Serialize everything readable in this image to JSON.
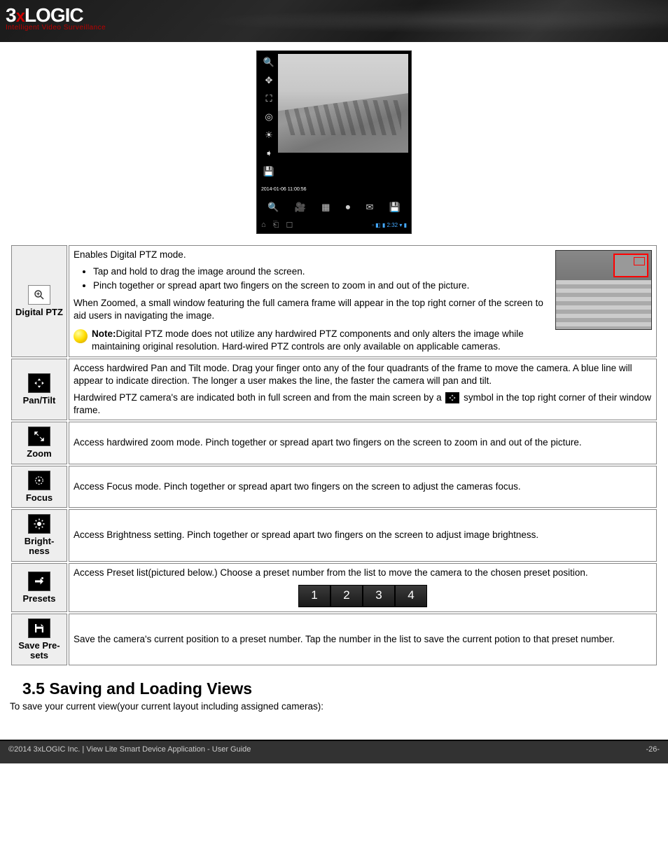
{
  "logo": {
    "brand": "3xLOGIC",
    "tagline": "Intelligent Video Surveillance"
  },
  "screenshot": {
    "timestamp": "2014-01-06 11:00:56",
    "clock": "2:32"
  },
  "rows": {
    "digitalptz": {
      "label": "Digital PTZ",
      "intro": "Enables Digital PTZ mode.",
      "b1": "Tap and hold to drag the image around the screen.",
      "b2": "Pinch together or spread apart two fingers on the screen to zoom in and out of the picture.",
      "zoomed": "When Zoomed, a small window featuring the full camera frame will appear in the top right corner of the screen to aid users in navigating the image.",
      "note_label": "Note:",
      "note": "Digital PTZ mode does not utilize any hardwired PTZ components and only alters the image while maintaining original resolution. Hard-wired PTZ controls are only available on applicable cameras."
    },
    "pantilt": {
      "label": "Pan/Tilt",
      "p1": "Access hardwired Pan and Tilt mode. Drag your finger onto any of the four quadrants of the frame to move the camera. A blue line will appear to indicate direction. The longer a user makes the line, the faster the camera will pan and tilt.",
      "p2a": "Hardwired PTZ camera's are indicated both in full screen and from the main screen by a ",
      "p2b": " symbol in the top right corner of their window frame."
    },
    "zoom": {
      "label": "Zoom",
      "p": "Access hardwired zoom mode. Pinch together or spread apart two fingers on the screen to zoom in and out of the picture."
    },
    "focus": {
      "label": "Focus",
      "p": "Access Focus mode. Pinch together or spread apart two fingers on the screen to adjust the cameras focus."
    },
    "brightness": {
      "label": "Bright-\nness",
      "p": "Access Brightness setting. Pinch together or spread apart two fingers on the screen to adjust image brightness."
    },
    "presets": {
      "label": "Presets",
      "p": "Access Preset list(pictured below.) Choose a preset number from the list to move the camera to the chosen preset position.",
      "nums": [
        "1",
        "2",
        "3",
        "4"
      ]
    },
    "savepresets": {
      "label": "Save Pre-\nsets",
      "p": "Save the camera's current position to a preset number. Tap the number in the list to save the current potion to that preset number."
    }
  },
  "section": {
    "num": "3.5",
    "title": "Saving and Loading Views",
    "body": "To save your current view(your current layout including assigned cameras):"
  },
  "footer": {
    "left": "©2014 3xLOGIC Inc.  |  View Lite Smart Device Application - User Guide",
    "right": "-26-"
  }
}
